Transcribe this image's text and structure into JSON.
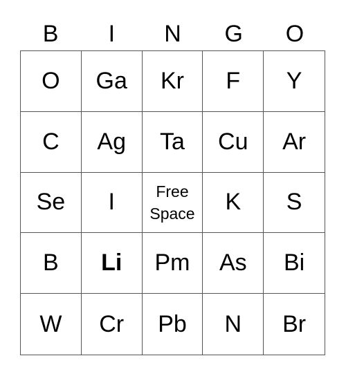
{
  "header": [
    "B",
    "I",
    "N",
    "G",
    "O"
  ],
  "cells": [
    [
      "O",
      "Ga",
      "Kr",
      "F",
      "Y"
    ],
    [
      "C",
      "Ag",
      "Ta",
      "Cu",
      "Ar"
    ],
    [
      "Se",
      "I",
      "Free Space",
      "K",
      "S"
    ],
    [
      "B",
      "Li",
      "Pm",
      "As",
      "Bi"
    ],
    [
      "W",
      "Cr",
      "Pb",
      "N",
      "Br"
    ]
  ],
  "free_space": {
    "line1": "Free",
    "line2": "Space"
  }
}
